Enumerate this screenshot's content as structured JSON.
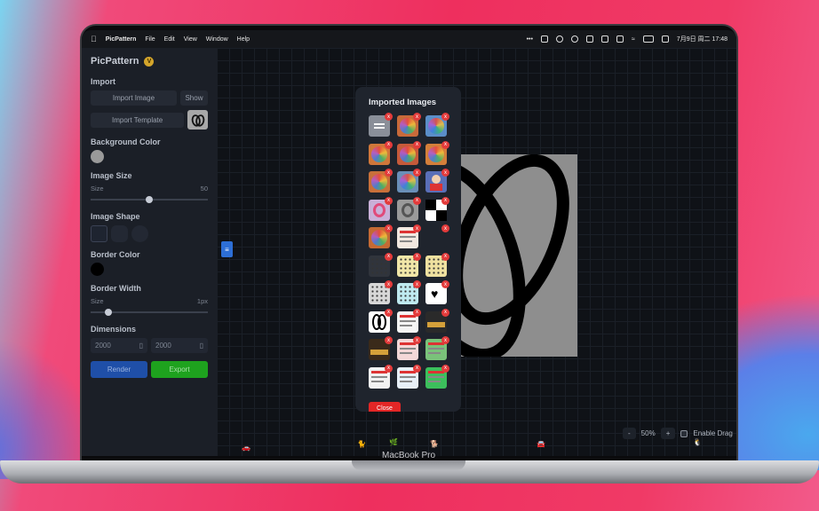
{
  "menubar": {
    "app_name": "PicPattern",
    "items": [
      "File",
      "Edit",
      "View",
      "Window"
    ],
    "help": "Help",
    "clock": "7月9日 周二  17:48"
  },
  "sidebar": {
    "title": "PicPattern",
    "version_badge": "V",
    "import_section": "Import",
    "import_image_label": "Import Image",
    "show_label": "Show",
    "import_template_label": "Import Template",
    "background_color_section": "Background Color",
    "background_color": "#9a9a9a",
    "image_size_section": "Image Size",
    "size_label": "Size",
    "size_value": "50",
    "size_slider_fraction": 0.5,
    "image_shape_section": "Image Shape",
    "border_color_section": "Border Color",
    "border_color": "#000000",
    "border_width_section": "Border Width",
    "border_size_label": "Size",
    "border_width_value": "1px",
    "border_slider_fraction": 0.05,
    "dimensions_section": "Dimensions",
    "width_value": "2000",
    "height_value": "2000",
    "render_label": "Render",
    "export_label": "Export"
  },
  "modal": {
    "title": "Imported Images",
    "close_label": "Close",
    "remove_glyph": "x",
    "thumbnails": [
      {
        "kind": "doc",
        "bg": "#8a8f99"
      },
      {
        "kind": "colorful",
        "bg": "#c86a3a"
      },
      {
        "kind": "colorful",
        "bg": "#5a8ec8"
      },
      {
        "kind": "colorful",
        "bg": "#d0773a"
      },
      {
        "kind": "colorful",
        "bg": "#c65a3a"
      },
      {
        "kind": "colorful",
        "bg": "#d47f3a"
      },
      {
        "kind": "colorful",
        "bg": "#c8703a"
      },
      {
        "kind": "colorful",
        "bg": "#6a8fb8"
      },
      {
        "kind": "character",
        "bg": "#5a6fb8"
      },
      {
        "kind": "logo-color",
        "bg": "#c9b0d8"
      },
      {
        "kind": "logo-gray",
        "bg": "#9a9a9a"
      },
      {
        "kind": "checker",
        "bg": "#ffffff"
      },
      {
        "kind": "colorful",
        "bg": "#c46a34"
      },
      {
        "kind": "text-card",
        "bg": "#f2e8e0"
      },
      {
        "kind": "empty",
        "bg": "#1f242d"
      },
      {
        "kind": "dots-dark",
        "bg": "#30343c"
      },
      {
        "kind": "dots-yellow",
        "bg": "#f1e7a8"
      },
      {
        "kind": "dots-yellow",
        "bg": "#efe1a0"
      },
      {
        "kind": "heart-dots",
        "bg": "#d8d8d8"
      },
      {
        "kind": "cyan-dots",
        "bg": "#bfeaf0"
      },
      {
        "kind": "heart-black",
        "bg": "#ffffff"
      },
      {
        "kind": "logo-bw",
        "bg": "#ffffff"
      },
      {
        "kind": "text-card",
        "bg": "#f5f5f5"
      },
      {
        "kind": "photo",
        "bg": "#2a2a2a"
      },
      {
        "kind": "photo-dark",
        "bg": "#3a2a1a"
      },
      {
        "kind": "poster-red",
        "bg": "#f4d8d8"
      },
      {
        "kind": "poster-green",
        "bg": "#7ac27a"
      },
      {
        "kind": "poster-red",
        "bg": "#f2f2f2"
      },
      {
        "kind": "poster-mixed",
        "bg": "#e8f0f8"
      },
      {
        "kind": "poster-green",
        "bg": "#3cbf5c"
      }
    ]
  },
  "canvas": {
    "preview_bg": "#8e8e8e",
    "zoom_minus": "-",
    "zoom_value": "50%",
    "zoom_plus": "+",
    "enable_drag_label": "Enable Drag"
  },
  "laptop": {
    "brand": "MacBook Pro"
  },
  "colors": {
    "accent_blue": "#1f4fa8",
    "export_green": "#1ea21e",
    "close_red": "#e32626"
  }
}
